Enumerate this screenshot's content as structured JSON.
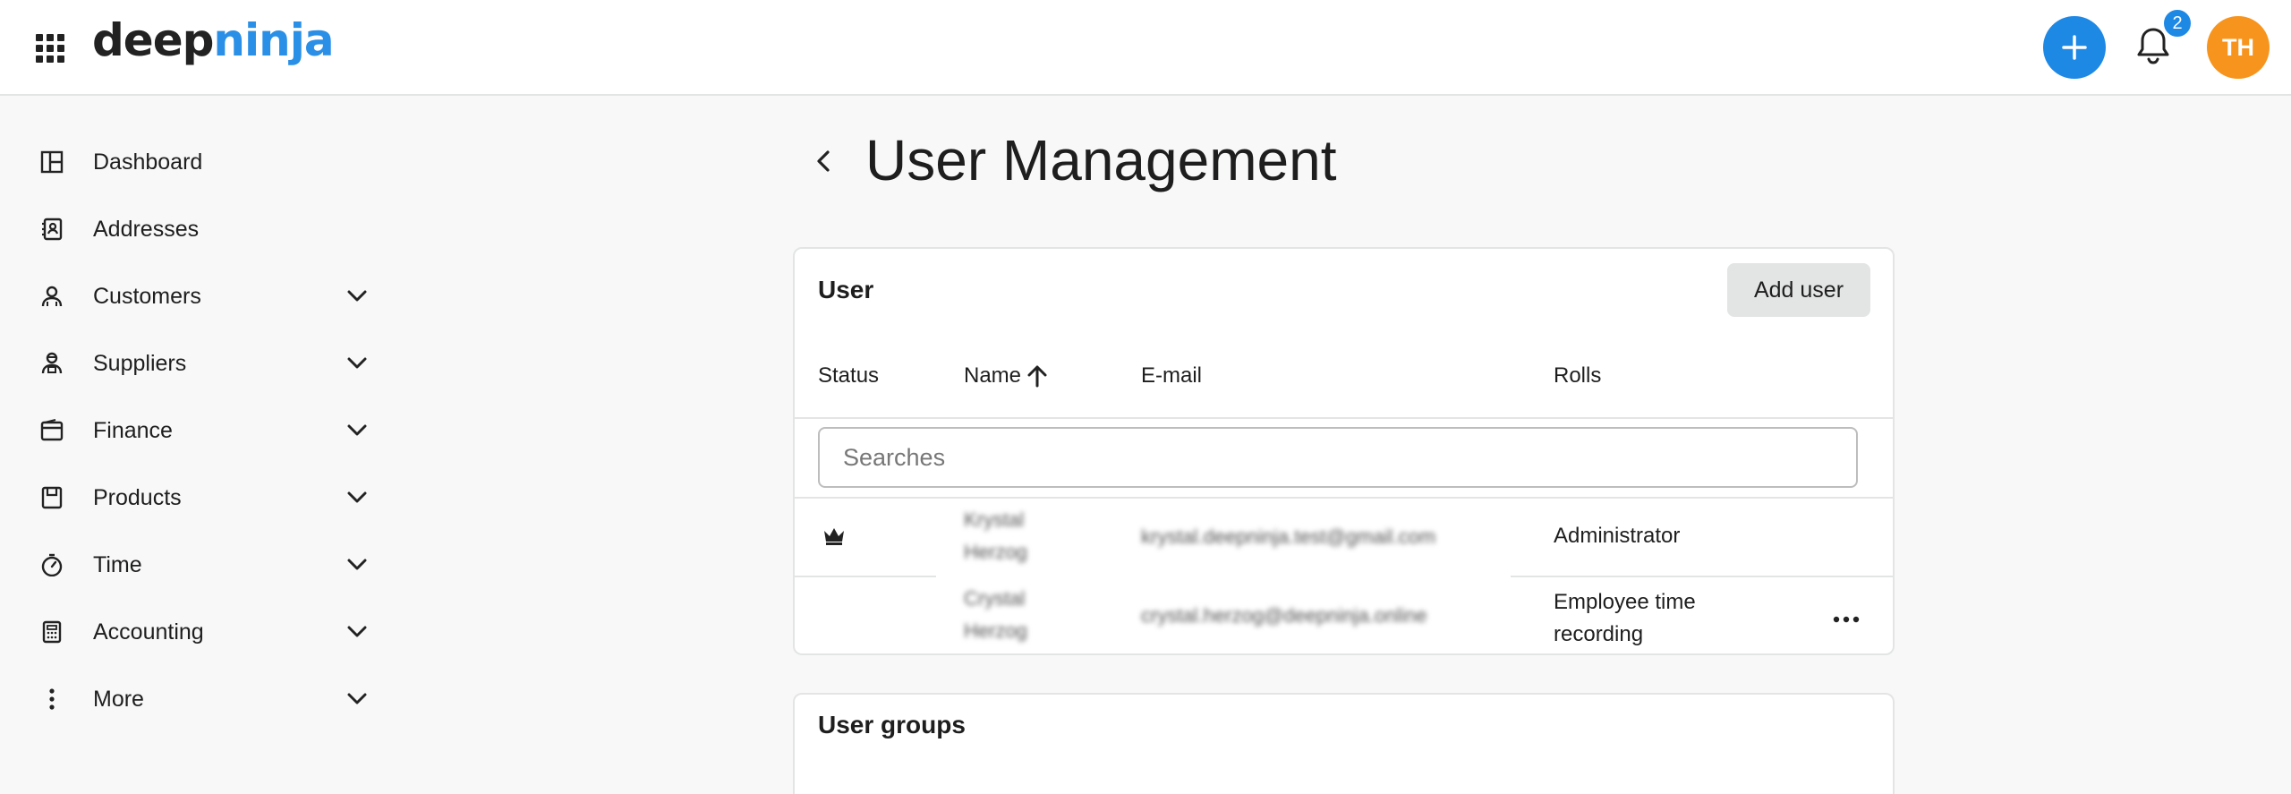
{
  "brand": {
    "logo_part1": "deep",
    "logo_part2": "ninja"
  },
  "header": {
    "notification_count": "2",
    "avatar_initials": "TH"
  },
  "sidebar": {
    "items": [
      {
        "label": "Dashboard",
        "icon": "dashboard-icon",
        "expandable": false
      },
      {
        "label": "Addresses",
        "icon": "address-book-icon",
        "expandable": false
      },
      {
        "label": "Customers",
        "icon": "customers-icon",
        "expandable": true
      },
      {
        "label": "Suppliers",
        "icon": "suppliers-icon",
        "expandable": true
      },
      {
        "label": "Finance",
        "icon": "wallet-icon",
        "expandable": true
      },
      {
        "label": "Products",
        "icon": "products-icon",
        "expandable": true
      },
      {
        "label": "Time",
        "icon": "stopwatch-icon",
        "expandable": true
      },
      {
        "label": "Accounting",
        "icon": "calculator-icon",
        "expandable": true
      },
      {
        "label": "More",
        "icon": "more-vertical-icon",
        "expandable": true
      }
    ]
  },
  "page": {
    "title": "User Management"
  },
  "user_card": {
    "title": "User",
    "add_button": "Add user",
    "columns": {
      "status": "Status",
      "name": "Name",
      "email": "E-mail",
      "roles": "Rolls"
    },
    "search_placeholder": "Searches",
    "rows": [
      {
        "status_icon": "crown-icon",
        "name_line1": "Krystal",
        "name_line2": "Herzog",
        "email": "krystal.deepninja.test@gmail.com",
        "role": "Administrator"
      },
      {
        "status_icon": "",
        "name_line1": "Crystal",
        "name_line2": "Herzog",
        "email": "crystal.herzog@deepninja.online",
        "role_line1": "Employee time",
        "role_line2": "recording"
      }
    ]
  },
  "groups_card": {
    "title": "User groups"
  },
  "colors": {
    "accent": "#1e88e5",
    "avatar": "#f7941d"
  }
}
